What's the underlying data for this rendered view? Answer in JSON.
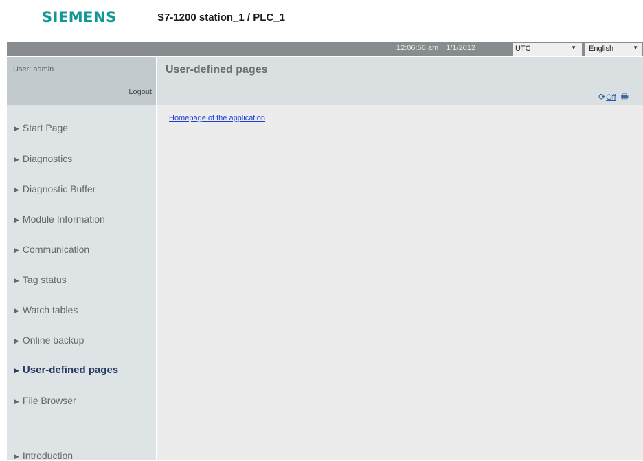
{
  "header": {
    "brand": "SIEMENS",
    "station_title": "S7-1200 station_1 / PLC_1"
  },
  "topbar": {
    "time": "12:06:56 am",
    "date": "1/1/2012",
    "timezone": "UTC",
    "language": "English"
  },
  "user": {
    "label": "User: admin",
    "logout": "Logout"
  },
  "nav": {
    "items": [
      {
        "label": "Start Page"
      },
      {
        "label": "Diagnostics"
      },
      {
        "label": "Diagnostic Buffer"
      },
      {
        "label": "Module Information"
      },
      {
        "label": "Communication"
      },
      {
        "label": "Tag status"
      },
      {
        "label": "Watch tables"
      },
      {
        "label": "Online backup"
      },
      {
        "label": "User-defined pages",
        "active": true
      },
      {
        "label": "File Browser"
      },
      {
        "label": "Introduction"
      }
    ]
  },
  "main": {
    "title": "User-defined pages",
    "refresh_state": "Off",
    "link": "Homepage of the application"
  },
  "icons": {
    "nav_marker": "triangle-right-icon",
    "refresh": "refresh-icon",
    "print": "print-icon",
    "dropdown": "triangle-down-icon"
  },
  "colors": {
    "brand": "#129696",
    "topbar": "#888c8e",
    "sidebar": "#dee3e6",
    "active_nav": "#243a61",
    "link": "#1f3fd9"
  }
}
